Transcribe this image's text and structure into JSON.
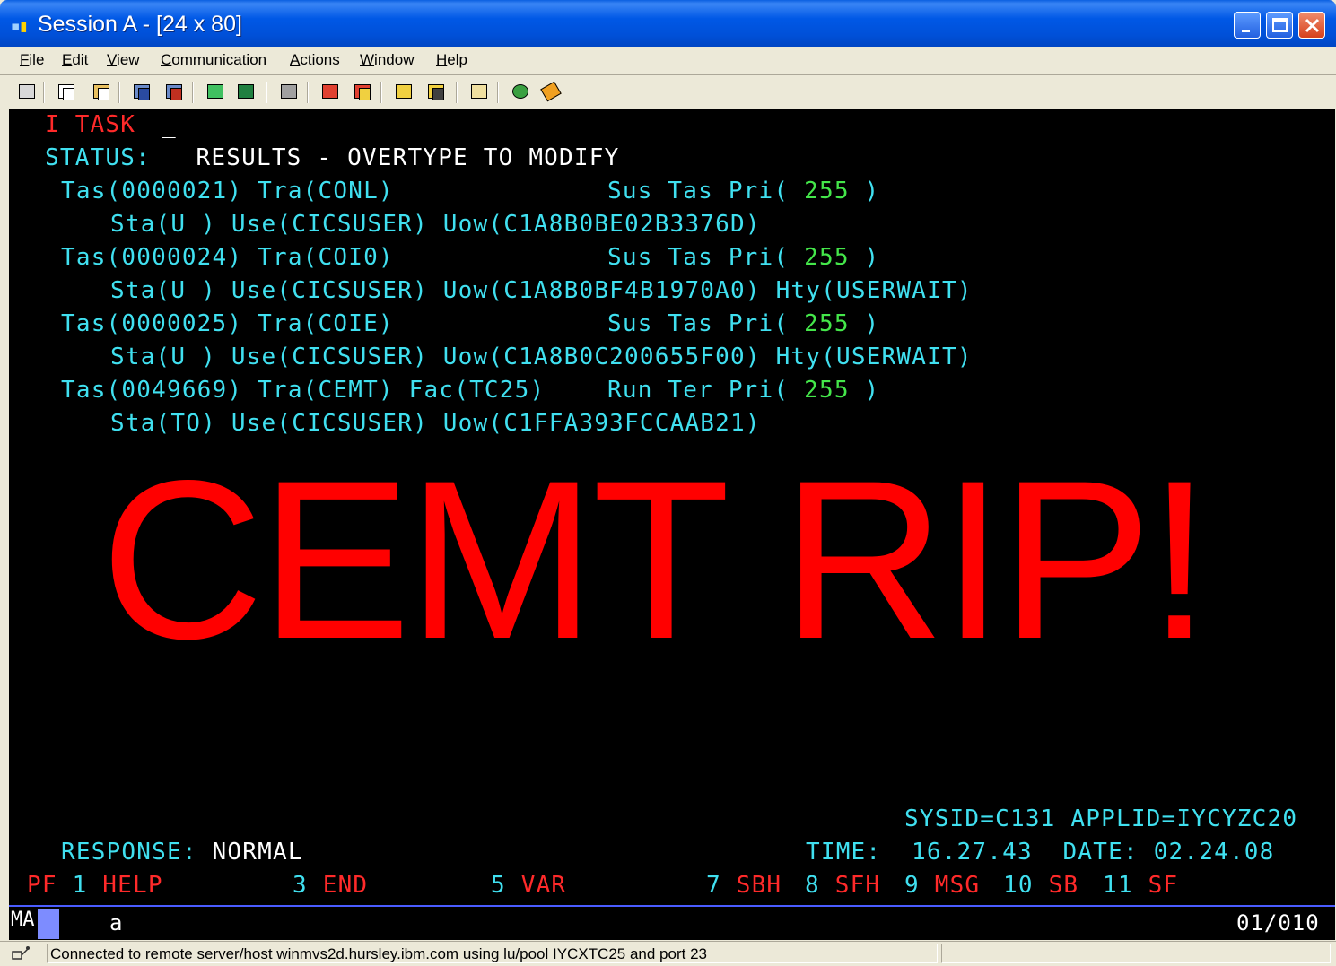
{
  "window": {
    "title": "Session A - [24 x 80]",
    "app_icon": "terminal-session-icon"
  },
  "menu": [
    "File",
    "Edit",
    "View",
    "Communication",
    "Actions",
    "Window",
    "Help"
  ],
  "toolbar": {
    "icons": [
      "print-screen-icon",
      "copy-icon",
      "paste-icon",
      "send-file-icon",
      "receive-file-icon",
      "display-setup-icon",
      "keyboard-map-icon",
      "macro-record-icon",
      "macro-play-icon",
      "macro-stop-icon",
      "play-icon",
      "record-icon",
      "clipboard-icon",
      "globe-icon",
      "help-icon"
    ]
  },
  "terminal": {
    "command": "I TASK",
    "status_label": "STATUS:",
    "status_text": "RESULTS - OVERTYPE TO MODIFY",
    "tasks": [
      {
        "tas": "Tas(0000021)",
        "tra": "Tra(CONL)",
        "fac": "",
        "state": "Sus Tas Pri(",
        "pri": "255",
        "close": ")",
        "sta": "Sta(U )",
        "use": "Use(CICSUSER)",
        "uow": "Uow(C1A8B0BE02B3376D)",
        "hty": ""
      },
      {
        "tas": "Tas(0000024)",
        "tra": "Tra(COI0)",
        "fac": "",
        "state": "Sus Tas Pri(",
        "pri": "255",
        "close": ")",
        "sta": "Sta(U )",
        "use": "Use(CICSUSER)",
        "uow": "Uow(C1A8B0BF4B1970A0)",
        "hty": "Hty(USERWAIT)"
      },
      {
        "tas": "Tas(0000025)",
        "tra": "Tra(COIE)",
        "fac": "",
        "state": "Sus Tas Pri(",
        "pri": "255",
        "close": ")",
        "sta": "Sta(U )",
        "use": "Use(CICSUSER)",
        "uow": "Uow(C1A8B0C200655F00)",
        "hty": "Hty(USERWAIT)"
      },
      {
        "tas": "Tas(0049669)",
        "tra": "Tra(CEMT)",
        "fac": "Fac(TC25)",
        "state": "Run Ter Pri(",
        "pri": "255",
        "close": ")",
        "sta": "Sta(TO)",
        "use": "Use(CICSUSER)",
        "uow": "Uow(C1FFA393FCCAAB21)",
        "hty": ""
      }
    ],
    "overlay_text": "CEMT RIP!",
    "sysid": "SYSID=C131",
    "applid": "APPLID=IYCYZC20",
    "response_label": "RESPONSE:",
    "response_value": "NORMAL",
    "time_label": "TIME:",
    "time_value": "16.27.43",
    "date_label": "DATE:",
    "date_value": "02.24.08",
    "pf_keys": [
      {
        "key": "PF 1",
        "label": "HELP"
      },
      {
        "key": "3",
        "label": "END"
      },
      {
        "key": "5",
        "label": "VAR"
      },
      {
        "key": "7",
        "label": "SBH"
      },
      {
        "key": "8",
        "label": "SFH"
      },
      {
        "key": "9",
        "label": "MSG"
      },
      {
        "key": "10",
        "label": "SB"
      },
      {
        "key": "11",
        "label": "SF"
      }
    ]
  },
  "oia": {
    "indicator": "MA",
    "session": "a",
    "cursor_pos": "01/010"
  },
  "statusbar": {
    "text": "Connected to remote server/host winmvs2d.hursley.ibm.com using lu/pool IYCXTC25 and port 23"
  },
  "colors": {
    "background": "#000000",
    "cyan": "#40e0f0",
    "red": "#ff2a2a",
    "green": "#44e64a",
    "white": "#ffffff",
    "overlay": "#ff0000"
  }
}
